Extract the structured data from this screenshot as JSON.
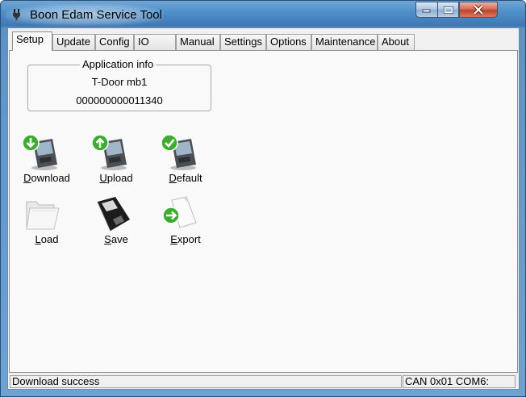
{
  "window": {
    "title": "Boon Edam Service Tool",
    "app_icon": "plug-icon"
  },
  "window_controls": {
    "minimize_icon": "minimize-icon",
    "maximize_icon": "maximize-icon",
    "close_icon": "close-icon"
  },
  "tabs": [
    {
      "label": "Setup",
      "active": true
    },
    {
      "label": "Update"
    },
    {
      "label": "Config"
    },
    {
      "label": "IO"
    },
    {
      "label": "Manual"
    },
    {
      "label": "Settings"
    },
    {
      "label": "Options"
    },
    {
      "label": "Maintenance"
    },
    {
      "label": "About"
    }
  ],
  "app_info": {
    "legend": "Application info",
    "name": "T-Door mb1",
    "serial": "000000000011340"
  },
  "actions": [
    {
      "label": "Download",
      "icon": "pda-download-icon"
    },
    {
      "label": "Upload",
      "icon": "pda-upload-icon"
    },
    {
      "label": "Default",
      "icon": "pda-default-icon"
    },
    {
      "label": "Load",
      "icon": "folder-icon"
    },
    {
      "label": "Save",
      "icon": "floppy-disk-icon"
    },
    {
      "label": "Export",
      "icon": "export-document-icon"
    }
  ],
  "status": {
    "message": "Download success",
    "connection": "CAN 0x01 COM6:"
  },
  "colors": {
    "accent_green": "#3cae2f",
    "title_bar": "#4f8fc9",
    "close_button": "#c1432a"
  }
}
